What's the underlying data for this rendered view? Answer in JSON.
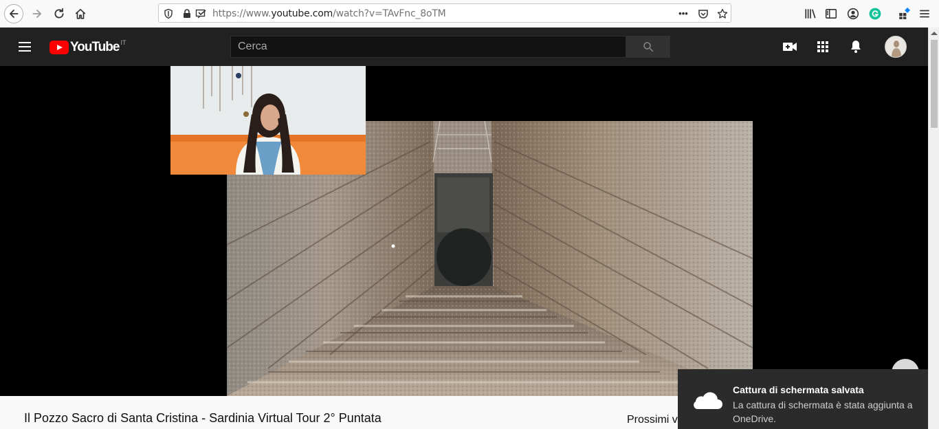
{
  "browser": {
    "url_prefix": "https://www.",
    "url_domain": "youtube.com",
    "url_path": "/watch?v=TAvFnc_8oTM",
    "extensions_dots": "•••"
  },
  "youtube": {
    "logo_word": "YouTube",
    "country": "IT",
    "search_placeholder": "Cerca"
  },
  "video": {
    "title": "Il Pozzo Sacro di Santa Cristina - Sardinia Virtual Tour 2° Puntata",
    "up_next": "Prossimi v"
  },
  "toast": {
    "title": "Cattura di schermata salvata",
    "body": "La cattura di schermata è stata aggiunta a OneDrive."
  },
  "colors": {
    "yt_bg": "#212121",
    "yt_red": "#ff0000",
    "toast_bg": "#2b2b2b"
  }
}
